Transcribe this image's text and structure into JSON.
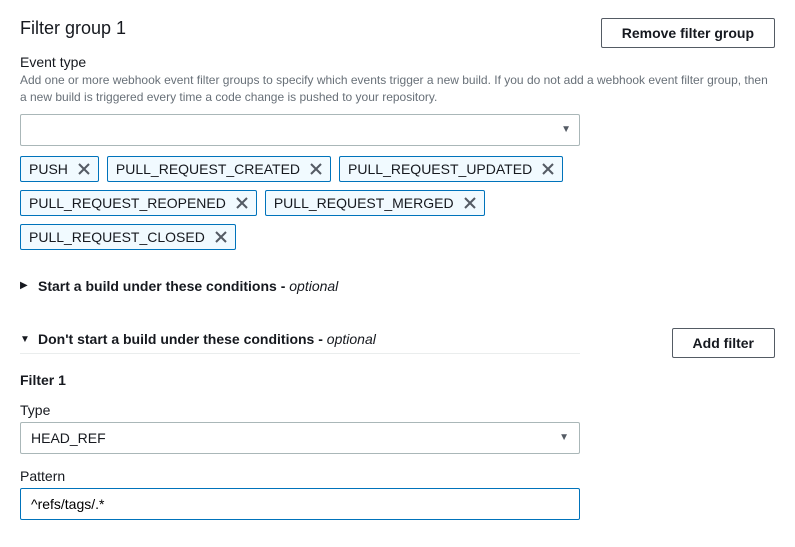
{
  "header": {
    "title": "Filter group 1",
    "remove_button": "Remove filter group"
  },
  "event_type": {
    "label": "Event type",
    "help": "Add one or more webhook event filter groups to specify which events trigger a new build. If you do not add a webhook event filter group, then a new build is triggered every time a code change is pushed to your repository.",
    "tags": [
      "PUSH",
      "PULL_REQUEST_CREATED",
      "PULL_REQUEST_UPDATED",
      "PULL_REQUEST_REOPENED",
      "PULL_REQUEST_MERGED",
      "PULL_REQUEST_CLOSED"
    ]
  },
  "sections": {
    "start": {
      "title": "Start a build under these conditions -",
      "optional": "optional"
    },
    "dont_start": {
      "title": "Don't start a build under these conditions -",
      "optional": "optional",
      "add_filter": "Add filter"
    }
  },
  "filter": {
    "name": "Filter 1",
    "type_label": "Type",
    "type_value": "HEAD_REF",
    "pattern_label": "Pattern",
    "pattern_value": "^refs/tags/.*"
  }
}
